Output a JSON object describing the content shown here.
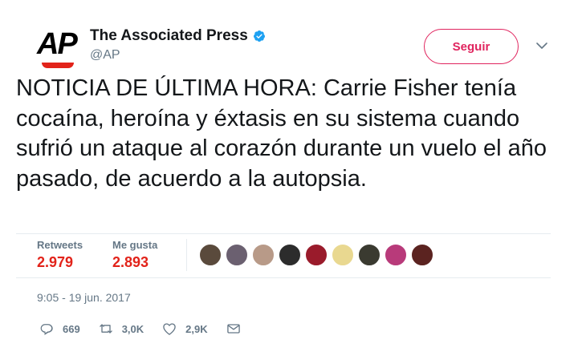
{
  "account": {
    "logo_text": "AP",
    "name": "The Associated Press",
    "handle": "@AP",
    "verified_icon": "verified-badge-icon",
    "brand_color": "#e2231a"
  },
  "follow_button": {
    "label": "Seguir",
    "color": "#e0245e"
  },
  "tweet": {
    "text": "NOTICIA DE ÚLTIMA HORA: Carrie Fisher tenía cocaína, heroína y éxtasis en su sistema cuando sufrió un ataque al corazón durante un vuelo el año pasado, de acuerdo a la autopsia."
  },
  "stats": {
    "retweets_label": "Retweets",
    "retweets_value": "2.979",
    "likes_label": "Me gusta",
    "likes_value": "2.893"
  },
  "liker_avatars": [
    {
      "name": "avatar-1",
      "color": "#5a4a3c"
    },
    {
      "name": "avatar-2",
      "color": "#6b6070"
    },
    {
      "name": "avatar-3",
      "color": "#b89a88"
    },
    {
      "name": "avatar-4",
      "color": "#2c2c2c"
    },
    {
      "name": "avatar-5",
      "color": "#9a1b2b"
    },
    {
      "name": "avatar-6",
      "color": "#e9d890"
    },
    {
      "name": "avatar-7",
      "color": "#3a3a30"
    },
    {
      "name": "avatar-8",
      "color": "#b83a7a"
    },
    {
      "name": "avatar-9",
      "color": "#5b2320"
    }
  ],
  "timestamp": "9:05 - 19 jun. 2017",
  "actions": {
    "reply_count": "669",
    "retweet_count": "3,0K",
    "like_count": "2,9K"
  }
}
